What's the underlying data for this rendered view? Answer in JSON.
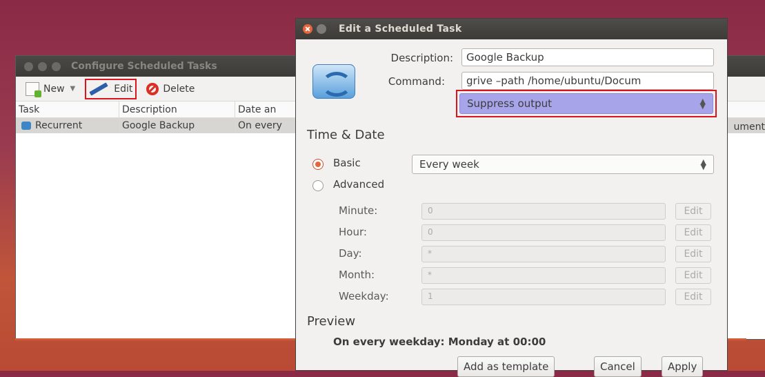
{
  "bg_window": {
    "title": "Configure Scheduled Tasks",
    "toolbar": {
      "new_label": "New",
      "edit_label": "Edit",
      "delete_label": "Delete"
    },
    "columns": [
      "Task",
      "Description",
      "Date an"
    ],
    "row": {
      "task": "Recurrent",
      "description": "Google Backup",
      "date": "On every"
    },
    "right_clip": "ument"
  },
  "dialog": {
    "title": "Edit a Scheduled Task",
    "description_label": "Description:",
    "description_value": "Google Backup",
    "command_label": "Command:",
    "command_value": "grive –path /home/ubuntu/Docum",
    "output_option": "Suppress output",
    "time_date_heading": "Time & Date",
    "basic_label": "Basic",
    "basic_selected": true,
    "frequency": "Every week",
    "advanced_label": "Advanced",
    "fields": [
      {
        "label": "Minute:",
        "value": "0",
        "button": "Edit"
      },
      {
        "label": "Hour:",
        "value": "0",
        "button": "Edit"
      },
      {
        "label": "Day:",
        "value": "*",
        "button": "Edit"
      },
      {
        "label": "Month:",
        "value": "*",
        "button": "Edit"
      },
      {
        "label": "Weekday:",
        "value": "1",
        "button": "Edit"
      }
    ],
    "preview_heading": "Preview",
    "preview_text": "On every weekday: Monday at 00:00",
    "buttons": {
      "template": "Add as template",
      "cancel": "Cancel",
      "apply": "Apply"
    }
  },
  "colors": {
    "accent_red": "#d9141e",
    "selection_purple": "#a8a4ea",
    "radio_orange": "#e2673a"
  }
}
